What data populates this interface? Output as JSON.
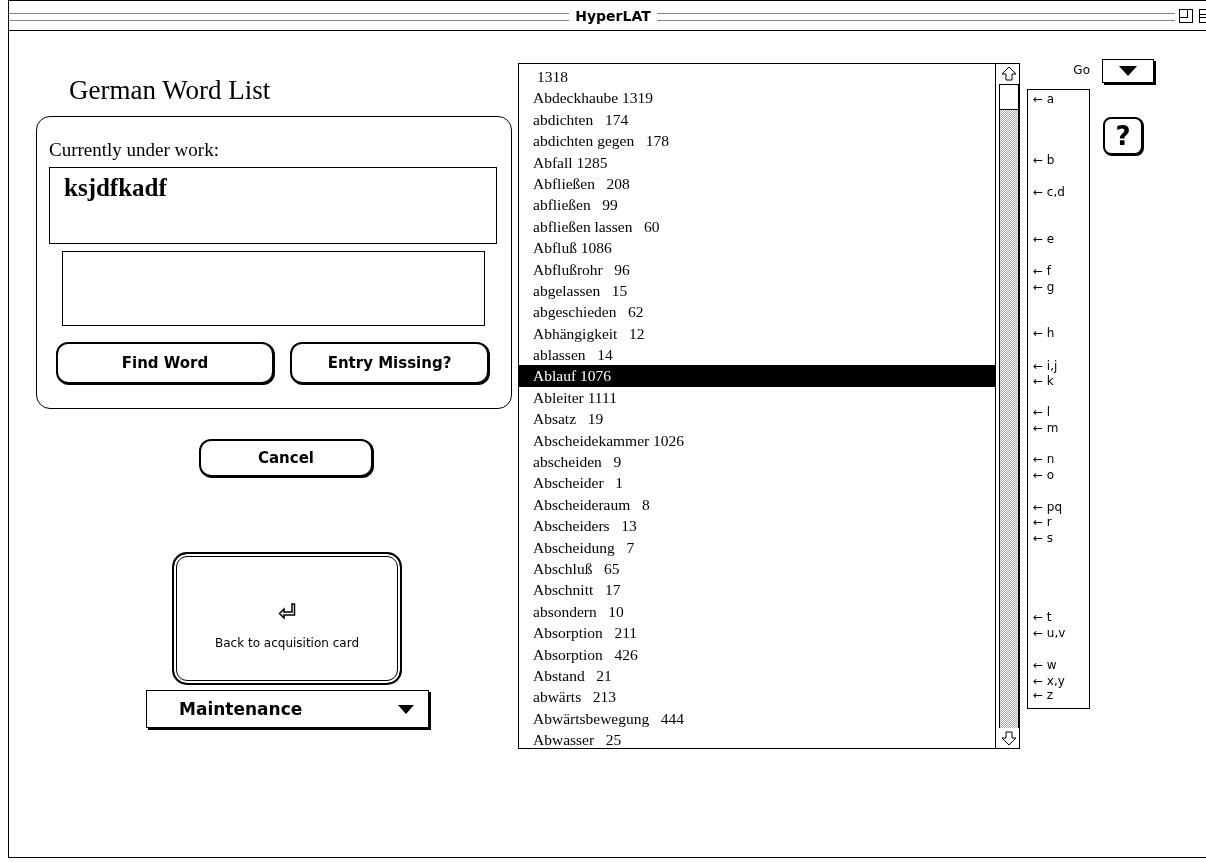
{
  "window": {
    "title": "HyperLAT"
  },
  "heading": "German Word List",
  "work_group": {
    "label": "Currently under work:",
    "current_word": "ksjdfkadf"
  },
  "buttons": [
    {
      "label": "Find Word"
    },
    {
      "label": "Entry Missing?"
    }
  ],
  "cancel_button": {
    "label": "Cancel"
  },
  "back_button": {
    "label": "Back to acquisition card"
  },
  "mode_menu": {
    "value": "Maintenance"
  },
  "go_menu": {
    "label": "Go"
  },
  "help_button": {
    "label": "?"
  },
  "word_list": [
    {
      "text": " 1318",
      "selected": false
    },
    {
      "text": "Abdeckhaube 1319",
      "selected": false
    },
    {
      "text": "abdichten   174",
      "selected": false
    },
    {
      "text": "abdichten gegen   178",
      "selected": false
    },
    {
      "text": "Abfall 1285",
      "selected": false
    },
    {
      "text": "Abfließen   208",
      "selected": false
    },
    {
      "text": "abfließen   99",
      "selected": false
    },
    {
      "text": "abfließen lassen   60",
      "selected": false
    },
    {
      "text": "Abfluß 1086",
      "selected": false
    },
    {
      "text": "Abflußrohr   96",
      "selected": false
    },
    {
      "text": "abgelassen   15",
      "selected": false
    },
    {
      "text": "abgeschieden   62",
      "selected": false
    },
    {
      "text": "Abhängigkeit   12",
      "selected": false
    },
    {
      "text": "ablassen   14",
      "selected": false
    },
    {
      "text": "Ablauf 1076",
      "selected": true
    },
    {
      "text": "Ableiter 1111",
      "selected": false
    },
    {
      "text": "Absatz   19",
      "selected": false
    },
    {
      "text": "Abscheidekammer 1026",
      "selected": false
    },
    {
      "text": "abscheiden   9",
      "selected": false
    },
    {
      "text": "Abscheider   1",
      "selected": false
    },
    {
      "text": "Abscheideraum   8",
      "selected": false
    },
    {
      "text": "Abscheiders   13",
      "selected": false
    },
    {
      "text": "Abscheidung   7",
      "selected": false
    },
    {
      "text": "Abschluß   65",
      "selected": false
    },
    {
      "text": "Abschnitt   17",
      "selected": false
    },
    {
      "text": "absondern   10",
      "selected": false
    },
    {
      "text": "Absorption   211",
      "selected": false
    },
    {
      "text": "Absorption   426",
      "selected": false
    },
    {
      "text": "Abstand   21",
      "selected": false
    },
    {
      "text": "abwärts   213",
      "selected": false
    },
    {
      "text": "Abwärtsbewegung   444",
      "selected": false
    },
    {
      "text": "Abwasser   25",
      "selected": false
    }
  ],
  "letter_index": [
    "← a",
    "← b",
    "← c,d",
    "← e",
    "← f",
    "← g",
    "← h",
    "← i,j",
    "← k",
    "← l",
    "← m",
    "← n",
    "← o",
    "← pq",
    "← r",
    "← s",
    "← t",
    "← u,v",
    "← w",
    "← x,y",
    "← z"
  ]
}
